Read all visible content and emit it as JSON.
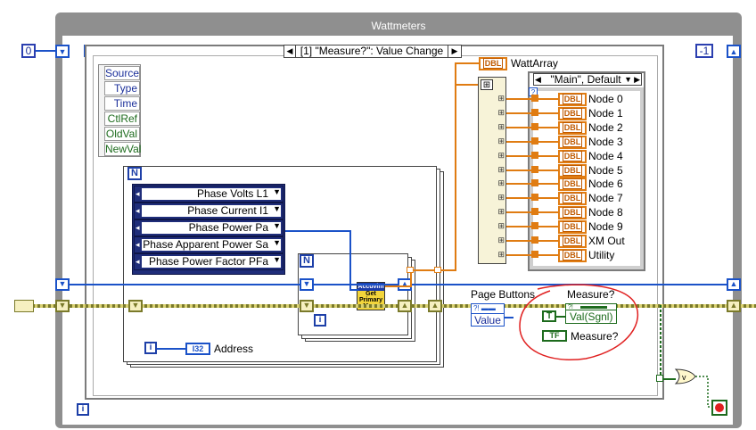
{
  "window": {
    "title": "Wattmeters"
  },
  "shift_register": {
    "left_value": "0",
    "right_value": "-1"
  },
  "event_case": {
    "selector_label": "[1] \"Measure?\": Value Change"
  },
  "event_data": {
    "items": [
      "Source",
      "Type",
      "Time",
      "CtlRef",
      "OldVal",
      "NewVal"
    ]
  },
  "loop": {
    "for_n_label": "N",
    "iteration_label": "i"
  },
  "property_node": {
    "items": [
      "Phase Volts L1",
      "Phase Current I1",
      "Phase Power Pa",
      "Phase Apparent Power Sa",
      "Phase Power Factor PFa"
    ]
  },
  "subvi": {
    "line1": "Accuvim",
    "line2": "Get",
    "line3": "Primary",
    "line4": "Meas"
  },
  "address": {
    "type": "I32",
    "label": "Address"
  },
  "watt_array": {
    "type": "DBL",
    "label": "WattArray"
  },
  "cluster_case": {
    "selector_label": "\"Main\", Default"
  },
  "nodes": {
    "type": "DBL",
    "labels": [
      "Node 0",
      "Node 1",
      "Node 2",
      "Node 3",
      "Node 4",
      "Node 5",
      "Node 6",
      "Node 7",
      "Node 8",
      "Node 9",
      "XM Out",
      "Utility"
    ]
  },
  "page_buttons": {
    "label": "Page Buttons",
    "value_label": "Value"
  },
  "measure": {
    "label": "Measure?",
    "val_label": "Val(Sgnl)",
    "tf_label": "Measure?",
    "bool_T": "T",
    "bool_TF": "TF"
  },
  "colors": {
    "orange_wire": "#e07c12",
    "blue_wire": "#1b52c8",
    "green_wire": "#1d6b1d",
    "red_annotation": "#e02020",
    "frame_gray": "#8f8f8f"
  }
}
